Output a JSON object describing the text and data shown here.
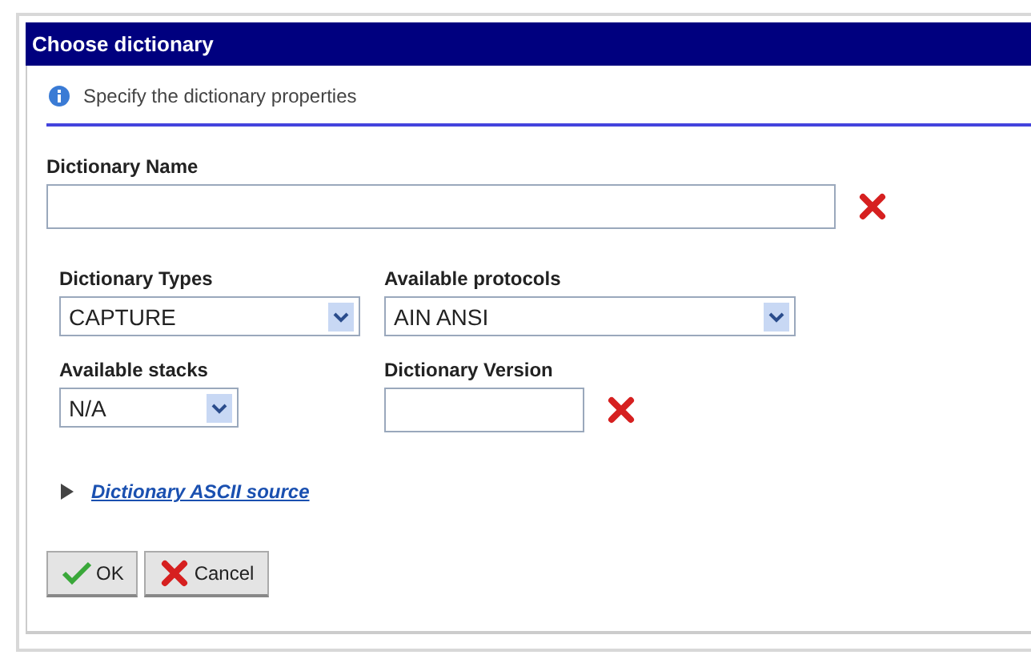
{
  "window": {
    "title": "Choose dictionary"
  },
  "info": "Specify the dictionary properties",
  "name_field": {
    "label": "Dictionary Name",
    "required": true
  },
  "types": {
    "label": "Dictionary Types",
    "value": "CAPTURE"
  },
  "protocols": {
    "label": "Available protocols",
    "value": "AIN ANSI"
  },
  "stacks": {
    "label": "Available stacks",
    "value": "N/A"
  },
  "version_field": {
    "label": "Dictionary Version",
    "required": true
  },
  "ascii_source": {
    "label": "Dictionary ASCII source",
    "expanded": false
  },
  "buttons": [
    {
      "kind": "ok",
      "label": "OK"
    },
    {
      "kind": "cancel",
      "label": "Cancel"
    }
  ]
}
